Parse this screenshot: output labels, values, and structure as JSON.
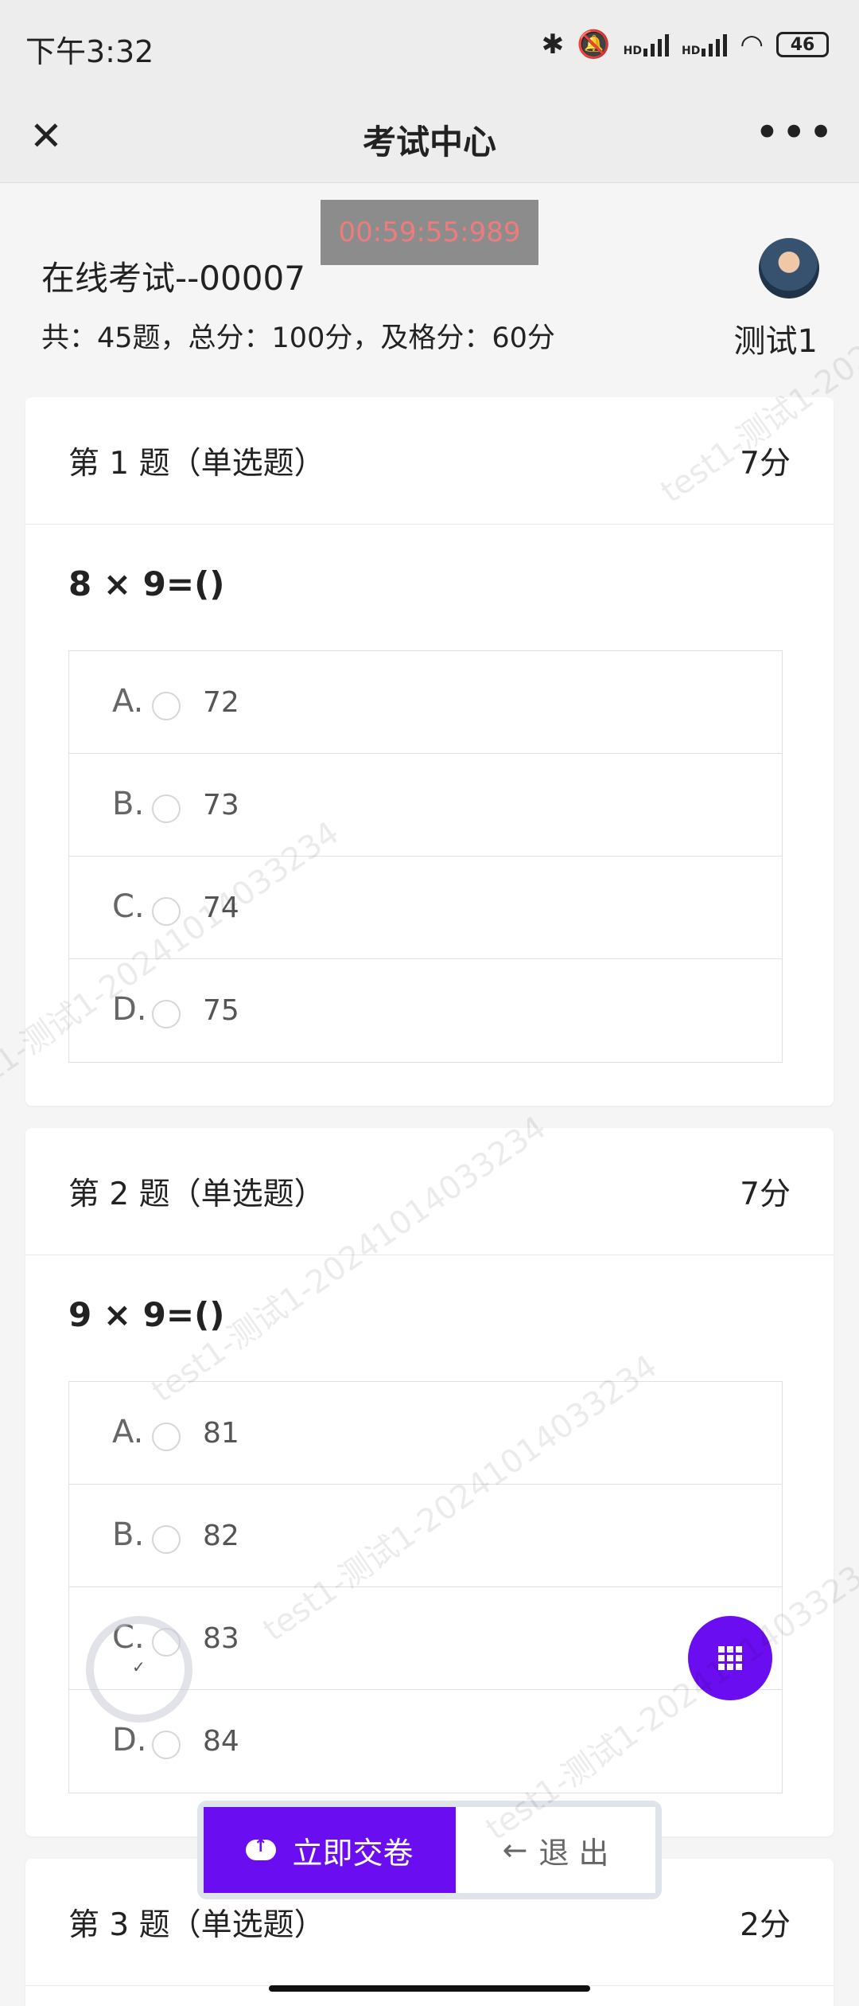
{
  "status_bar": {
    "time": "下午3:32",
    "battery": "46",
    "hd1": "HD",
    "hd2": "HD"
  },
  "nav": {
    "title": "考试中心",
    "close_icon": "close-icon",
    "more_icon": "more-icon"
  },
  "exam": {
    "timer": "00:59:55:989",
    "name": "在线考试--00007",
    "info": "共：45题，总分：100分，及格分：60分",
    "user": "测试1"
  },
  "questions": [
    {
      "title": "第 1 题（单选题）",
      "score": "7分",
      "text": "8 × 9=()",
      "options": [
        {
          "letter": "A.",
          "value": "72"
        },
        {
          "letter": "B.",
          "value": "73"
        },
        {
          "letter": "C.",
          "value": "74"
        },
        {
          "letter": "D.",
          "value": "75"
        }
      ]
    },
    {
      "title": "第 2 题（单选题）",
      "score": "7分",
      "text": "9 × 9=()",
      "options": [
        {
          "letter": "A.",
          "value": "81"
        },
        {
          "letter": "B.",
          "value": "82"
        },
        {
          "letter": "C.",
          "value": "83"
        },
        {
          "letter": "D.",
          "value": "84"
        }
      ]
    },
    {
      "title": "第 3 题（单选题）",
      "score": "2分"
    }
  ],
  "actions": {
    "submit": "立即交卷",
    "exit": "退 出",
    "exit_arrow": "←"
  },
  "watermark": "test1-测试1-20241014033234"
}
